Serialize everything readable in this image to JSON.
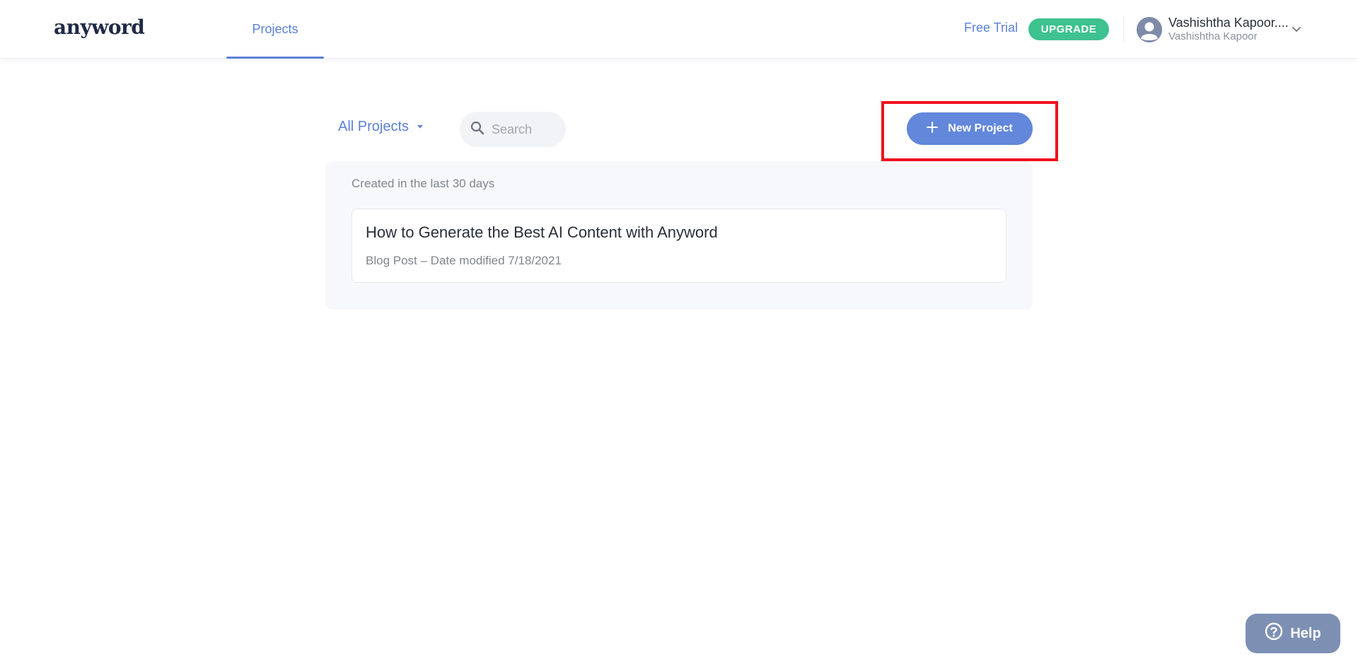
{
  "header": {
    "logo": "anyword",
    "nav": {
      "projects_label": "Projects"
    },
    "free_trial_label": "Free Trial",
    "upgrade_label": "UPGRADE",
    "user": {
      "name": "Vashishtha Kapoor....",
      "subtitle": "Vashishtha Kapoor"
    }
  },
  "toolbar": {
    "filter_label": "All Projects",
    "search_placeholder": "Search",
    "new_project_label": "New Project"
  },
  "projects": {
    "group_caption": "Created in the last 30 days",
    "items": [
      {
        "title": "How to Generate the Best AI Content with Anyword",
        "meta": "Blog Post – Date modified 7/18/2021"
      }
    ]
  },
  "help": {
    "label": "Help"
  },
  "colors": {
    "accent": "#5b80d6",
    "button_primary": "#6287db",
    "upgrade": "#3ec28f",
    "highlight": "#f0121e",
    "help": "#7d90b4"
  },
  "icons": {
    "search": "search-icon",
    "plus": "plus-icon",
    "dropdown": "caret-down-icon",
    "chevron": "chevron-down-icon",
    "avatar": "user-avatar-icon",
    "help": "question-circle-icon",
    "arrow": "annotation-arrow"
  }
}
